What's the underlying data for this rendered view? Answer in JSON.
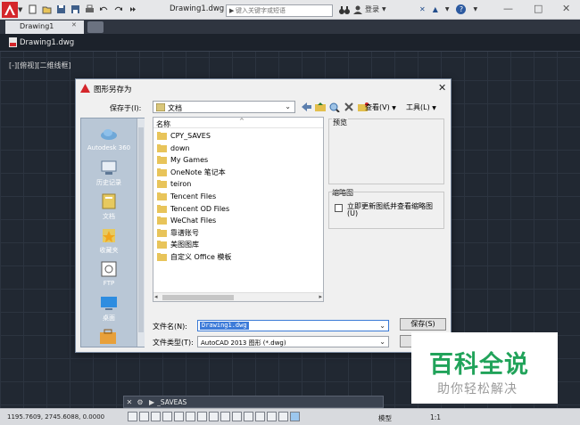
{
  "titlebar": {
    "document_title": "Drawing1.dwg",
    "search_placeholder": "键入关键字或短语",
    "login_label": "登录",
    "colors": {
      "app_red": "#d4262b",
      "bar": "#e6e7e9"
    }
  },
  "tabs": [
    {
      "label": "Drawing1"
    }
  ],
  "drawing": {
    "doc_name": "Drawing1.dwg",
    "viewport_label": "[-][俯视][二维线框]",
    "colors": {
      "background": "#212832"
    }
  },
  "dialog": {
    "title": "图形另存为",
    "savein_label": "保存于(I):",
    "savein_value": "文档",
    "view_menu": "查看(V)",
    "tools_menu": "工具(L)",
    "places": [
      {
        "label": "Autodesk 360",
        "icon": "cloud-icon"
      },
      {
        "label": "历史记录",
        "icon": "history-icon"
      },
      {
        "label": "文档",
        "icon": "documents-icon"
      },
      {
        "label": "收藏夹",
        "icon": "favorites-icon"
      },
      {
        "label": "FTP",
        "icon": "ftp-icon"
      },
      {
        "label": "桌面",
        "icon": "desktop-icon"
      }
    ],
    "filelist_header": "名称",
    "files": [
      "CPY_SAVES",
      "down",
      "My Games",
      "OneNote 笔记本",
      "teiron",
      "Tencent Files",
      "Tencent OD Files",
      "WeChat Files",
      "靠谱账号",
      "美图图库",
      "自定义 Office 模板"
    ],
    "preview_label": "预览",
    "thumbnail_label": "缩略图",
    "thumbnail_check_text": "立即更新图纸并查看缩略图(U)",
    "filename_label": "文件名(N):",
    "filename_value": "Drawing1.dwg",
    "filetype_label": "文件类型(T):",
    "filetype_value": "AutoCAD 2013 图形 (*.dwg)",
    "save_button": "保存(S)"
  },
  "cmdline": {
    "prompt": "▶",
    "value": "_SAVEAS"
  },
  "statusbar": {
    "coords": "1195.7609, 2745.6088, 0.0000",
    "model_label": "模型",
    "scale_label": "1:1"
  },
  "watermark": {
    "main": "百科全说",
    "sub": "助你轻松解决",
    "color": "#21a35a"
  }
}
